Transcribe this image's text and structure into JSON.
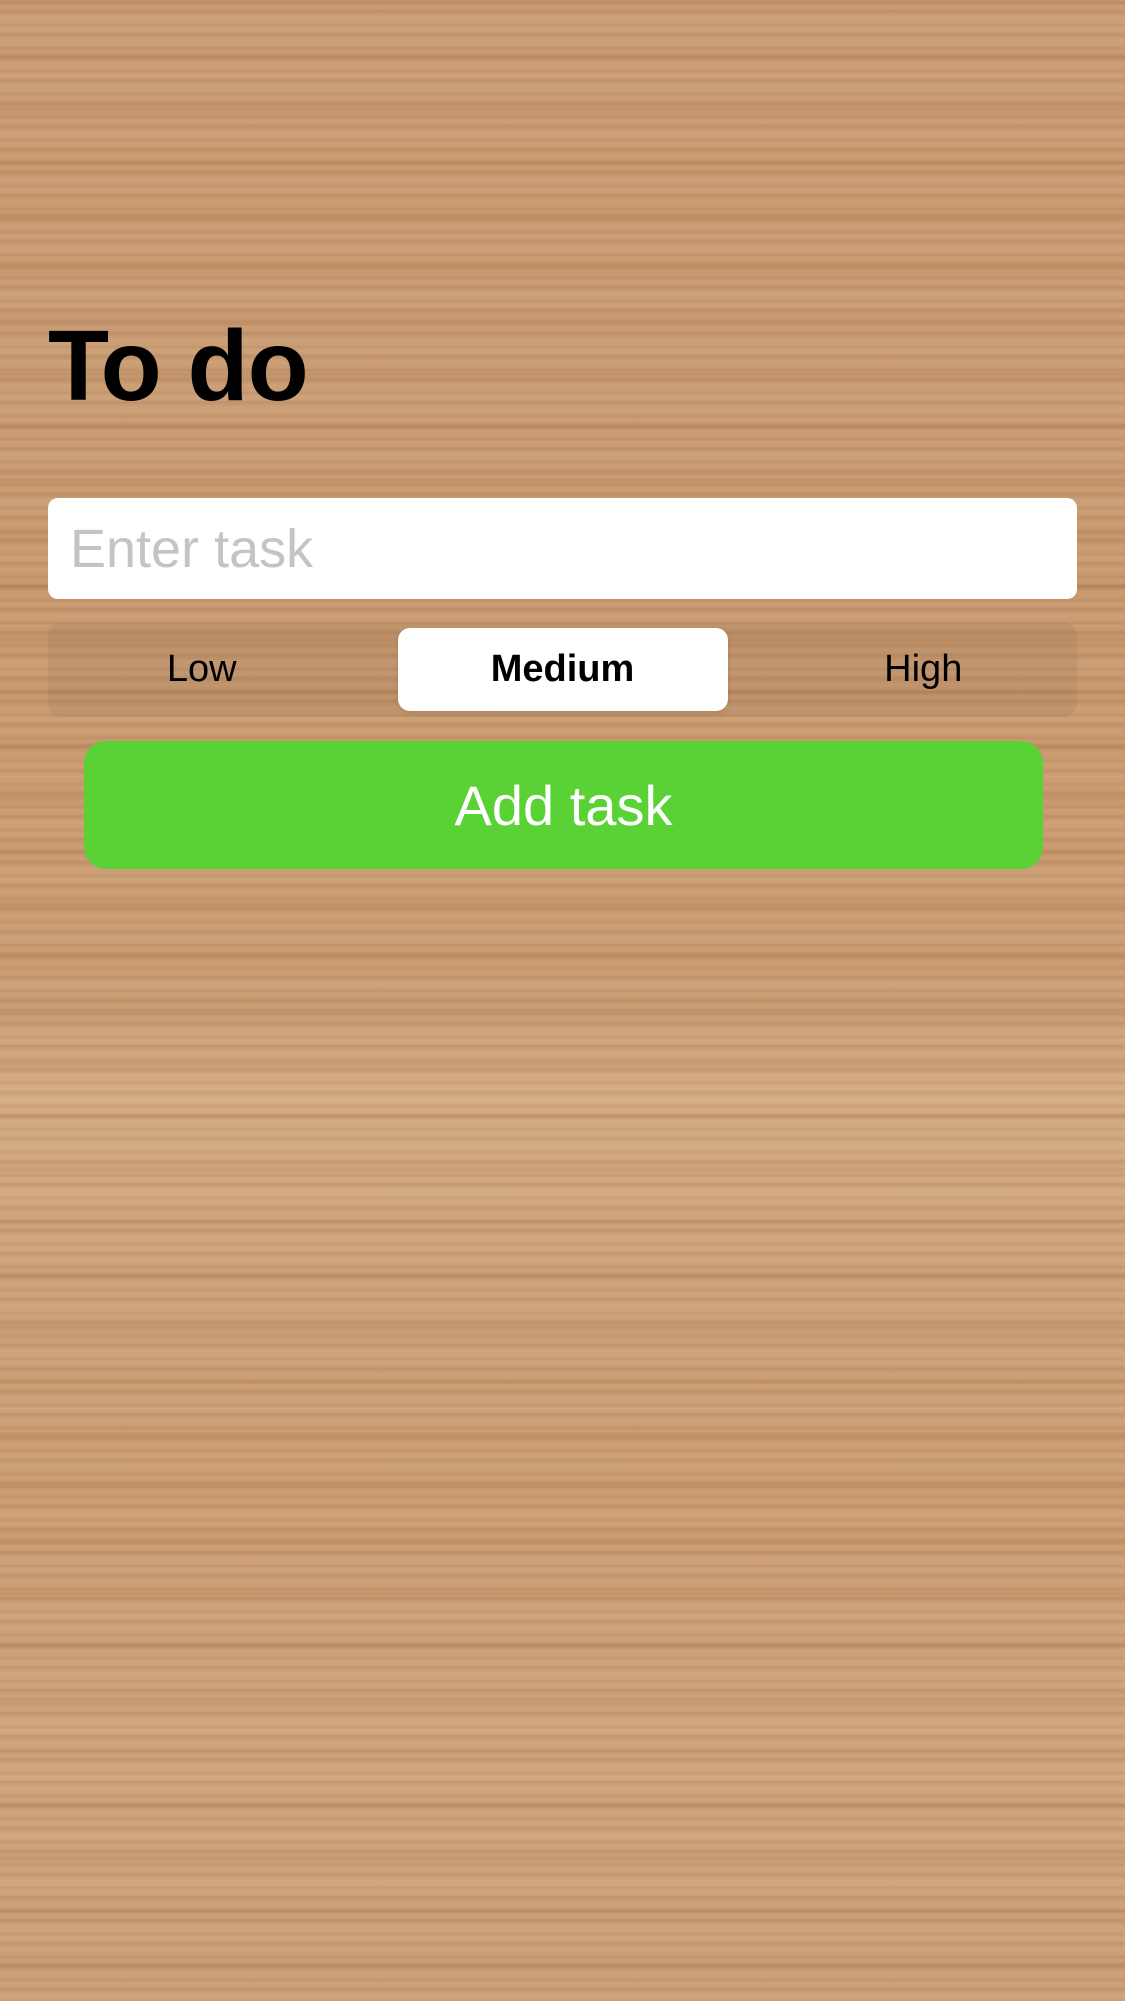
{
  "header": {
    "title": "To do"
  },
  "task_input": {
    "value": "",
    "placeholder": "Enter task"
  },
  "priority": {
    "options": [
      "Low",
      "Medium",
      "High"
    ],
    "selected": "Medium"
  },
  "actions": {
    "add_label": "Add task"
  },
  "colors": {
    "accent_green": "#5ad236",
    "placeholder_gray": "#c4c4c6",
    "background_wood": "#c99a70"
  }
}
